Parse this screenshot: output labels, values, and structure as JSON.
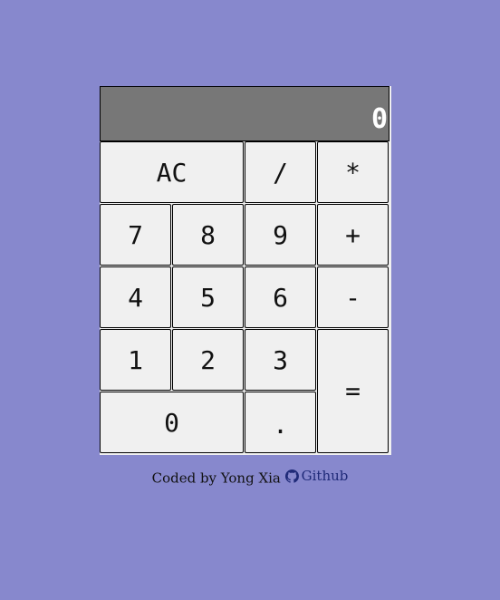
{
  "display": {
    "value": "0"
  },
  "keys": {
    "ac": "AC",
    "divide": "/",
    "multiply": "*",
    "seven": "7",
    "eight": "8",
    "nine": "9",
    "plus": "+",
    "four": "4",
    "five": "5",
    "six": "6",
    "minus": "-",
    "one": "1",
    "two": "2",
    "three": "3",
    "equals": "=",
    "zero": "0",
    "decimal": "."
  },
  "footer": {
    "credit": "Coded by Yong Xia",
    "link_label": "Github",
    "icon": "github-icon"
  },
  "colors": {
    "background": "#8788cd",
    "display_bg": "#777777",
    "key_bg": "#f0f0f0",
    "link": "#1f2a78"
  }
}
